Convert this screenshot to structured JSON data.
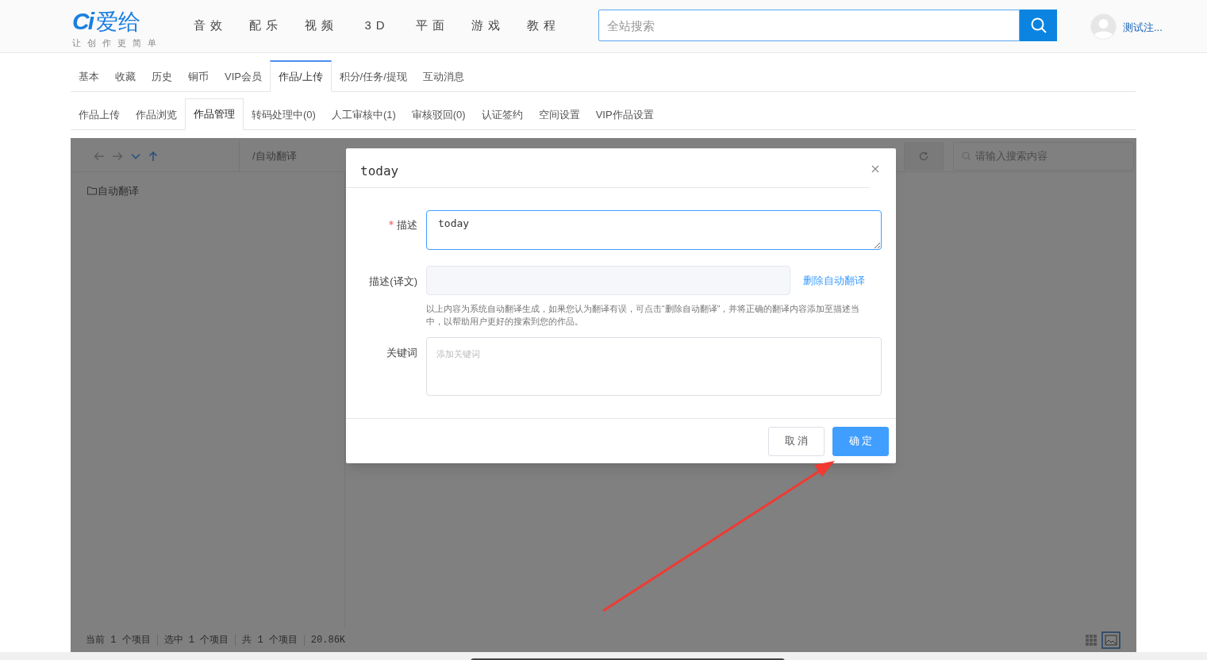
{
  "header": {
    "logo": {
      "mark": "Ci",
      "name": "爱给",
      "tagline": "让创作更简单"
    },
    "nav": [
      {
        "label": "音效"
      },
      {
        "label": "配乐"
      },
      {
        "label": "视频"
      },
      {
        "label": "3D"
      },
      {
        "label": "平面"
      },
      {
        "label": "游戏"
      },
      {
        "label": "教程"
      }
    ],
    "search": {
      "placeholder": "全站搜索"
    },
    "user": {
      "name": "测试注..."
    }
  },
  "tabs": [
    {
      "label": "基本",
      "selected": false
    },
    {
      "label": "收藏",
      "selected": false
    },
    {
      "label": "历史",
      "selected": false
    },
    {
      "label": "铜币",
      "selected": false
    },
    {
      "label": "VIP会员",
      "selected": false
    },
    {
      "label": "作品/上传",
      "selected": true
    },
    {
      "label": "积分/任务/提现",
      "selected": false
    },
    {
      "label": "互动消息",
      "selected": false
    }
  ],
  "subtabs": [
    {
      "label": "作品上传",
      "selected": false
    },
    {
      "label": "作品浏览",
      "selected": false
    },
    {
      "label": "作品管理",
      "selected": true
    },
    {
      "label": "转码处理中(0)",
      "selected": false
    },
    {
      "label": "人工审核中(1)",
      "selected": false
    },
    {
      "label": "审核驳回(0)",
      "selected": false
    },
    {
      "label": "认证签约",
      "selected": false
    },
    {
      "label": "空间设置",
      "selected": false
    },
    {
      "label": "VIP作品设置",
      "selected": false
    }
  ],
  "file_manager": {
    "path": "/自动翻译",
    "search": {
      "placeholder": "请输入搜索内容"
    },
    "tree": [
      {
        "label": "自动翻译"
      }
    ],
    "status_bar": [
      "当前 1 个项目",
      "选中 1 个项目",
      "共 1 个项目",
      "20.86K"
    ]
  },
  "dialog": {
    "title": "today",
    "fields": [
      {
        "label": "描述",
        "required": true,
        "value": "today "
      },
      {
        "label": "描述(译文)",
        "required": false,
        "link": "删除自动翻译",
        "hint": "以上内容为系统自动翻译生成，如果您认为翻译有误，可点击“删除自动翻译”，并将正确的翻译内容添加至描述当中，以帮助用户更好的搜索到您的作品。"
      },
      {
        "label": "关键词",
        "required": false,
        "placeholder": "添加关键词"
      }
    ],
    "buttons": [
      {
        "label": "取 消",
        "kind": "secondary"
      },
      {
        "label": "确 定",
        "kind": "primary"
      }
    ]
  }
}
